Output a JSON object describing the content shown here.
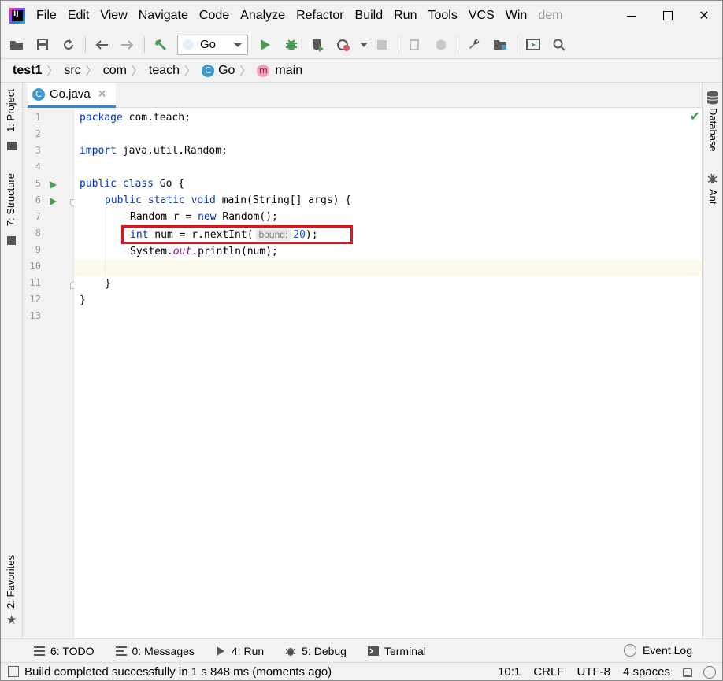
{
  "menubar": {
    "items": [
      "File",
      "Edit",
      "View",
      "Navigate",
      "Code",
      "Analyze",
      "Refactor",
      "Build",
      "Run",
      "Tools",
      "VCS",
      "Win"
    ],
    "project_title": "dem"
  },
  "toolbar": {
    "run_config": "Go"
  },
  "breadcrumb": {
    "items": [
      "test1",
      "src",
      "com",
      "teach",
      "Go",
      "main"
    ]
  },
  "left_strip": {
    "project": "1: Project",
    "structure": "7: Structure",
    "favorites": "2: Favorites"
  },
  "right_strip": {
    "database": "Database",
    "ant": "Ant"
  },
  "editor_tab": {
    "filename": "Go.java"
  },
  "code": {
    "line_numbers": [
      "1",
      "2",
      "3",
      "4",
      "5",
      "6",
      "7",
      "8",
      "9",
      "10",
      "11",
      "12",
      "13"
    ],
    "l1_kw": "package",
    "l1_rest": " com.teach;",
    "l3_kw": "import",
    "l3_rest": " java.util.Random;",
    "l5_kw": "public class",
    "l5_rest": " Go {",
    "l6_kw": "public static void",
    "l6_rest": " main(String[] args) {",
    "l7_a": "Random r = ",
    "l7_kw": "new",
    "l7_b": " Random();",
    "l8_kw": "int",
    "l8_a": " num = r.nextInt(",
    "l8_hint": "bound:",
    "l8_num": "20",
    "l8_b": ");",
    "l9_a": "System.",
    "l9_field": "out",
    "l9_b": ".println(num);",
    "l11": "}",
    "l12": "}"
  },
  "bottom_tools": {
    "todo": "6: TODO",
    "messages": "0: Messages",
    "run": "4: Run",
    "debug": "5: Debug",
    "terminal": "Terminal",
    "event_log": "Event Log"
  },
  "statusbar": {
    "message": "Build completed successfully in 1 s 848 ms (moments ago)",
    "position": "10:1",
    "line_sep": "CRLF",
    "encoding": "UTF-8",
    "indent": "4 spaces"
  }
}
